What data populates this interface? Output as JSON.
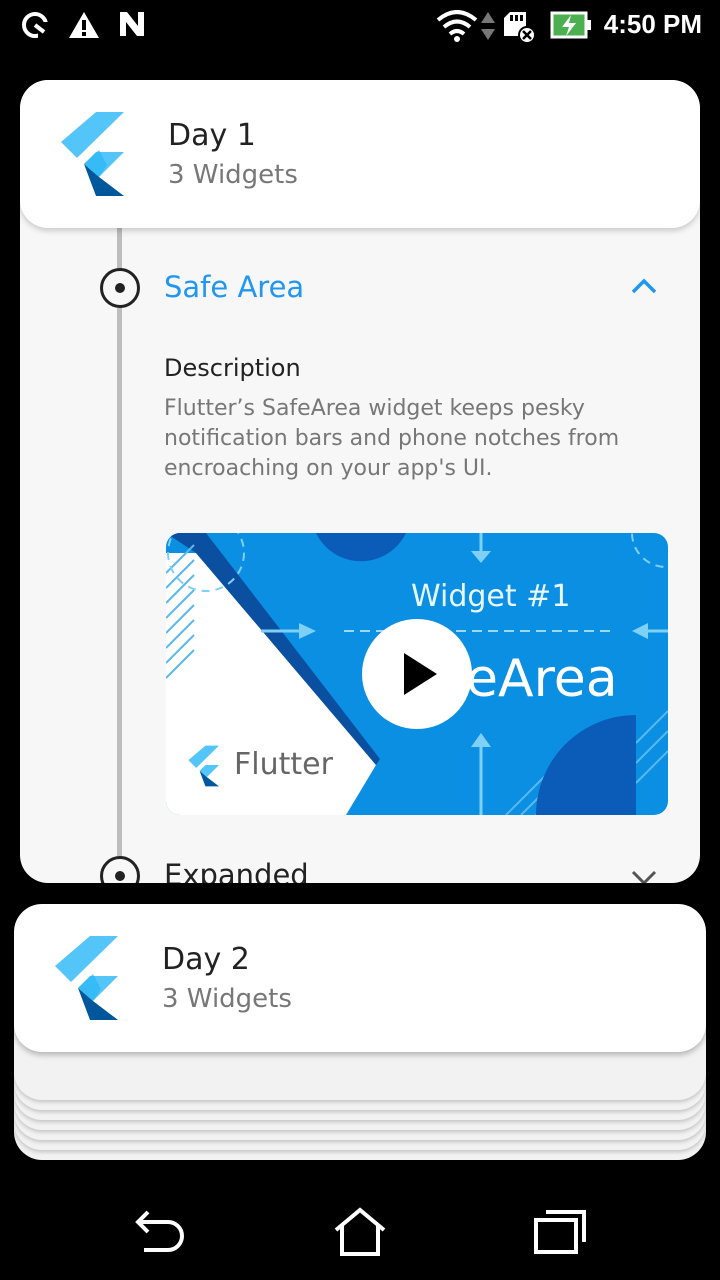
{
  "status_bar": {
    "time": "4:50 PM",
    "left_icons": [
      "speedometer-icon",
      "warning-icon",
      "n-logo-icon"
    ],
    "right_icons": [
      "wifi-icon",
      "data-arrows-icon",
      "sd-card-icon",
      "battery-charging-icon"
    ]
  },
  "day1": {
    "title": "Day 1",
    "subtitle": "3 Widgets",
    "items": [
      {
        "title": "Safe Area",
        "expanded": true,
        "description_heading": "Description",
        "description": "Flutter’s SafeArea widget keeps pesky notification bars and phone notches from encroaching on your app's UI.",
        "video": {
          "label": "Widget #1",
          "title_visible": "eArea",
          "brand": "Flutter"
        }
      },
      {
        "title": "Expanded",
        "expanded": false
      }
    ]
  },
  "day2": {
    "title": "Day 2",
    "subtitle": "3 Widgets"
  },
  "nav_bar": {
    "buttons": [
      "back-icon",
      "home-icon",
      "recents-icon"
    ]
  },
  "colors": {
    "accent": "#2196f3",
    "video_blue": "#0a8fe3",
    "flutter_light": "#54c5f8",
    "flutter_dark": "#01579b"
  }
}
